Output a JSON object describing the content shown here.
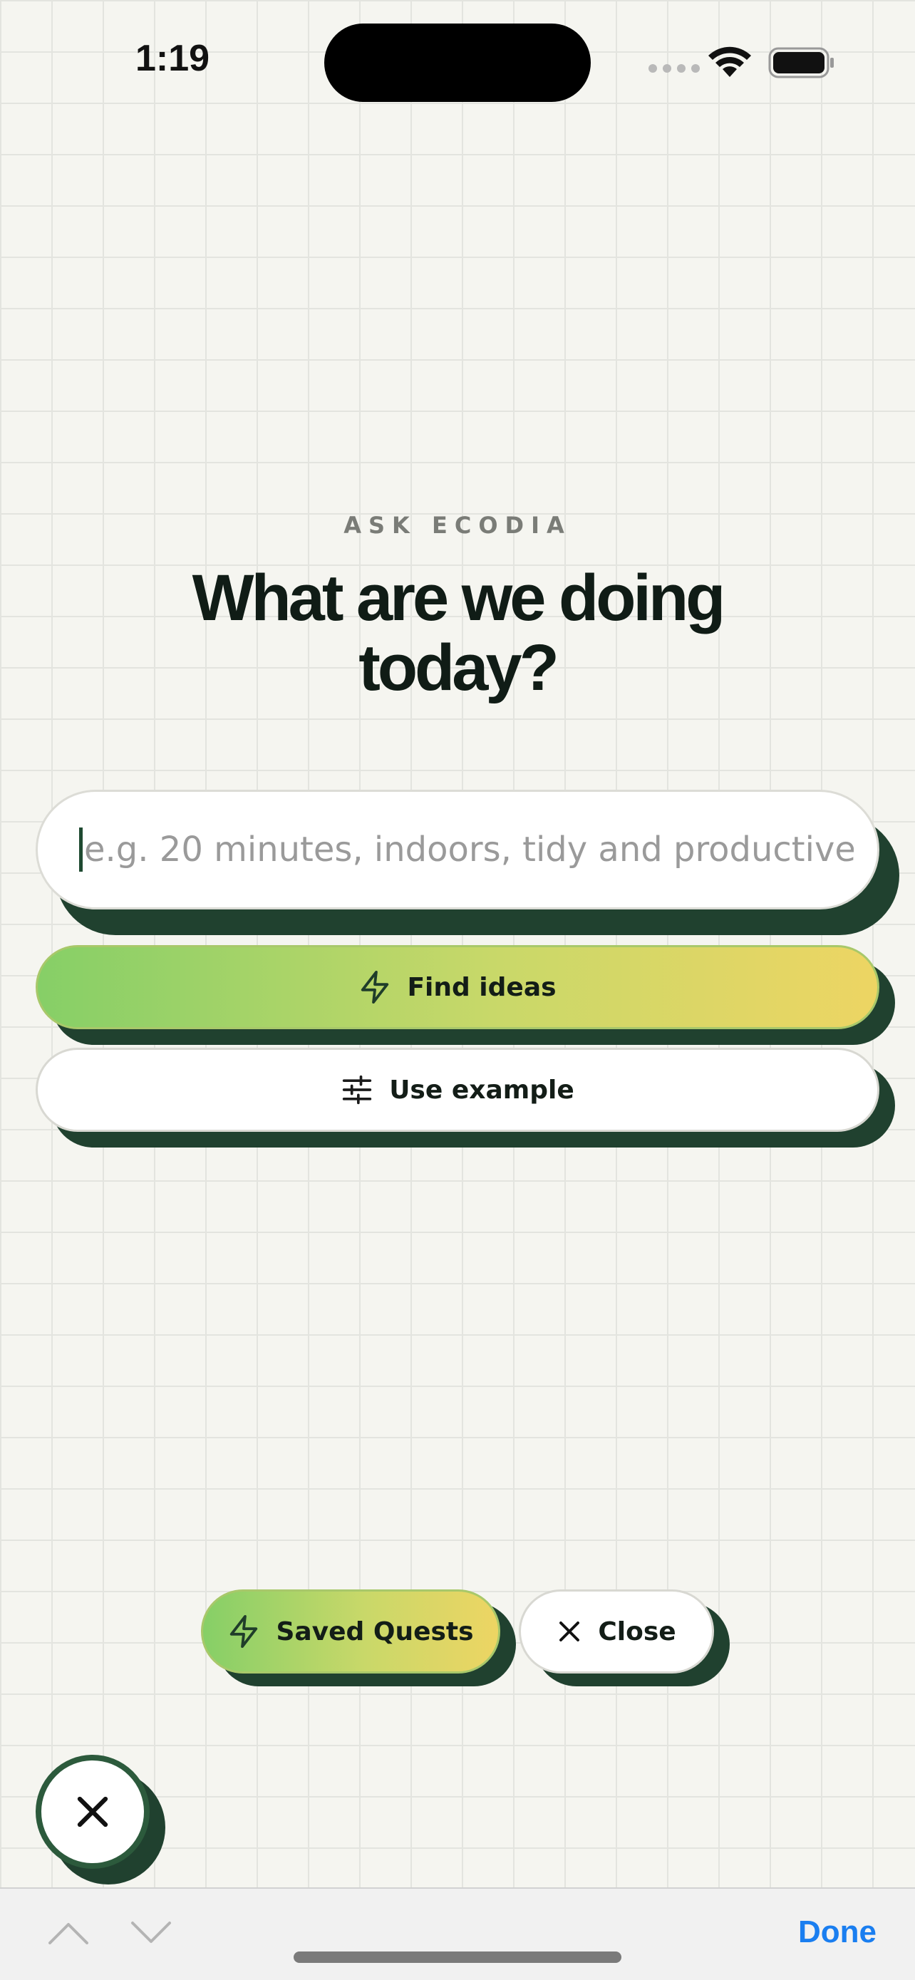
{
  "status_bar": {
    "time": "1:19"
  },
  "header": {
    "eyebrow": "ASK ECODIA",
    "title": "What are we doing today?"
  },
  "search": {
    "placeholder": "e.g. 20 minutes, indoors, tidy and productive",
    "value": ""
  },
  "buttons": {
    "find_ideas": "Find ideas",
    "use_example": "Use example",
    "saved_quests": "Saved Quests",
    "close": "Close"
  },
  "toolbar": {
    "done": "Done"
  },
  "icons": {
    "find_ideas": "lightning-icon",
    "use_example": "sliders-icon",
    "saved_quests": "lightning-icon",
    "close": "close-icon",
    "fab": "close-icon"
  },
  "colors": {
    "accent_dark_green": "#20412f",
    "gradient_start": "#86cf67",
    "gradient_end": "#edd563",
    "link_blue": "#1a7ef0",
    "background": "#f5f5f0"
  }
}
